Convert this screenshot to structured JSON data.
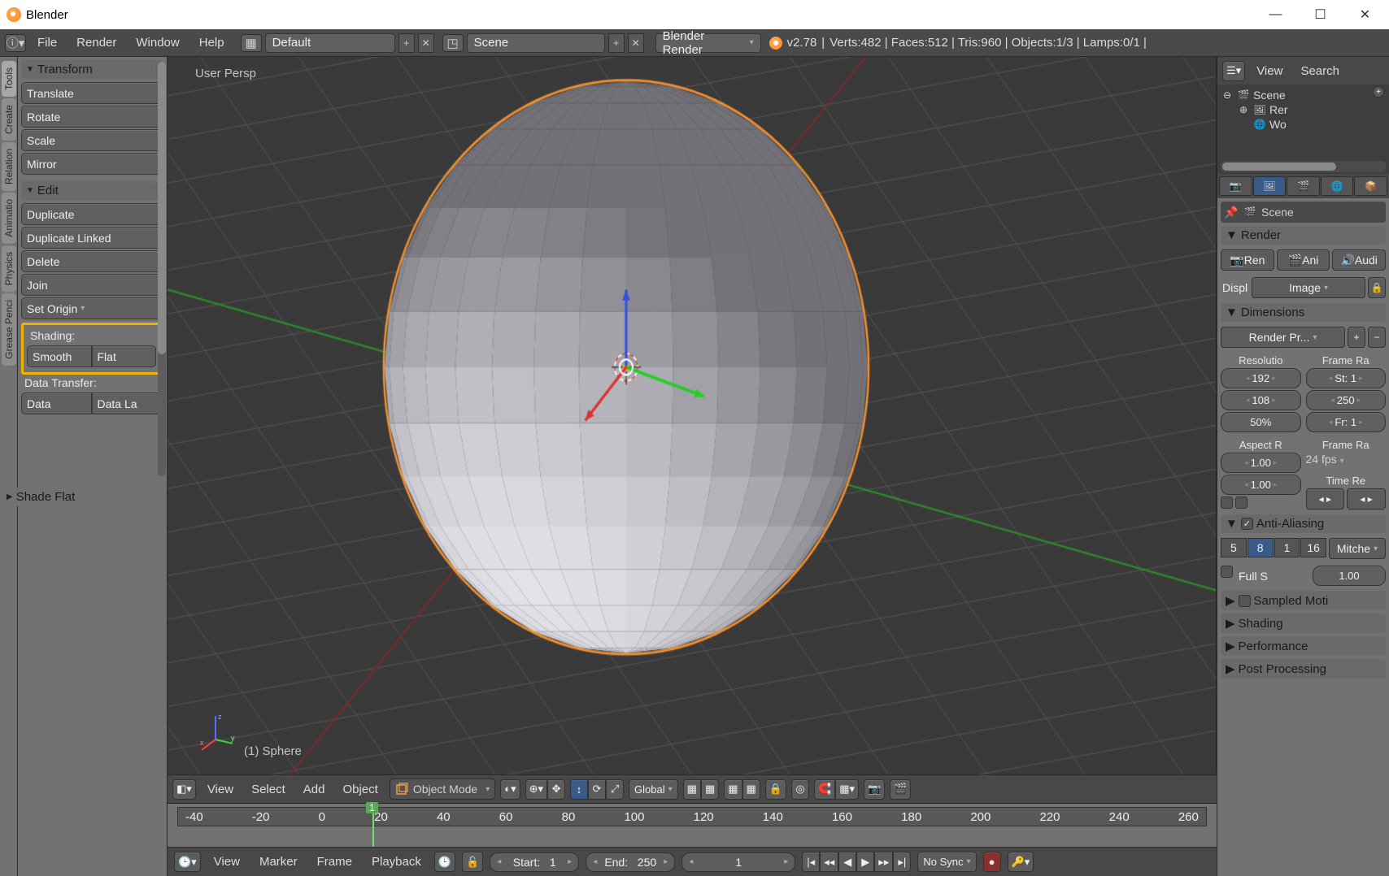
{
  "window_title": "Blender",
  "topbar": {
    "menus": [
      "File",
      "Render",
      "Window",
      "Help"
    ],
    "layout_name": "Default",
    "scene_name": "Scene",
    "render_engine": "Blender Render",
    "version": "v2.78",
    "stats": "Verts:482 | Faces:512 | Tris:960 | Objects:1/3 | Lamps:0/1 |"
  },
  "tooltabs": [
    "Tools",
    "Create",
    "Relation",
    "Animatio",
    "Physics",
    "Grease Penci"
  ],
  "tools": {
    "transform_header": "Transform",
    "translate": "Translate",
    "rotate": "Rotate",
    "scale": "Scale",
    "mirror": "Mirror",
    "edit_header": "Edit",
    "duplicate": "Duplicate",
    "duplicate_linked": "Duplicate Linked",
    "delete": "Delete",
    "join": "Join",
    "set_origin": "Set Origin",
    "shading_label": "Shading:",
    "smooth": "Smooth",
    "flat": "Flat",
    "data_transfer_label": "Data Transfer:",
    "data": "Data",
    "data_layout": "Data La"
  },
  "last_operator": "Shade Flat",
  "viewport": {
    "view_label": "User Persp",
    "object_label": "(1) Sphere",
    "header_menus": [
      "View",
      "Select",
      "Add",
      "Object"
    ],
    "mode": "Object Mode",
    "orientation": "Global"
  },
  "timeline": {
    "ticks": [
      "-40",
      "-20",
      "0",
      "20",
      "40",
      "60",
      "80",
      "100",
      "120",
      "140",
      "160",
      "180",
      "200",
      "220",
      "240",
      "260"
    ],
    "current_frame": "1",
    "header_menus": [
      "View",
      "Marker",
      "Frame",
      "Playback"
    ],
    "start_label": "Start:",
    "start": "1",
    "end_label": "End:",
    "end": "250",
    "frame": "1",
    "sync": "No Sync"
  },
  "outliner": {
    "header_menus": [
      "View",
      "Search"
    ],
    "scene": "Scene",
    "items": [
      "Rer",
      "Wo"
    ]
  },
  "properties": {
    "breadcrumb": "Scene",
    "render_header": "Render",
    "render_btn": "Ren",
    "anim_btn": "Ani",
    "audio_btn": "Audi",
    "display_label": "Displ",
    "display_value": "Image",
    "dimensions_header": "Dimensions",
    "preset": "Render Pr...",
    "res_label": "Resolutio",
    "frame_range_label": "Frame Ra",
    "res_x": "192",
    "res_y": "108",
    "res_pct": "50%",
    "frame_start": "St: 1",
    "frame_end": "250",
    "frame_step": "Fr: 1",
    "aspect_label": "Aspect R",
    "framerate_label": "Frame Ra",
    "aspect_x": "1.00",
    "aspect_y": "1.00",
    "fps": "24 fps",
    "time_remap": "Time Re",
    "aa_header": "Anti-Aliasing",
    "aa_samples": [
      "5",
      "8",
      "1",
      "16"
    ],
    "aa_filter": "Mitche",
    "full_sample_label": "Full S",
    "full_sample_val": "1.00",
    "sampled_motion": "Sampled Moti",
    "shading_header": "Shading",
    "performance_header": "Performance",
    "postproc_header": "Post Processing"
  }
}
